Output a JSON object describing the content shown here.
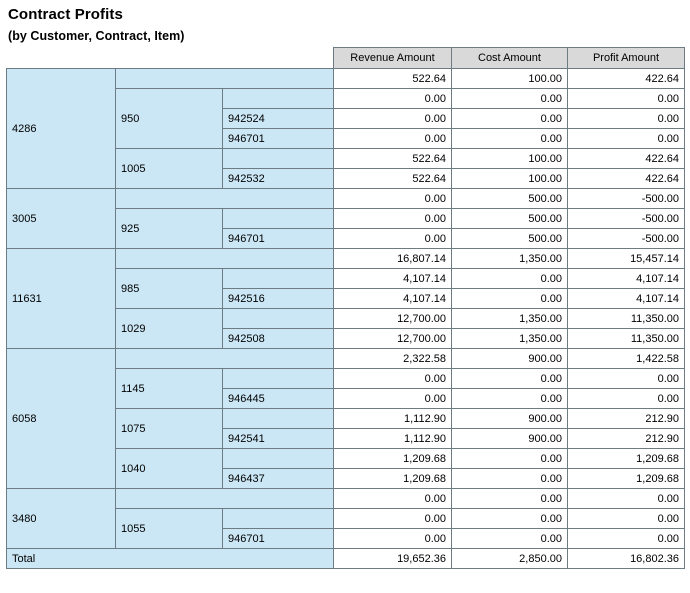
{
  "report": {
    "title": "Contract Profits",
    "subtitle": "(by Customer, Contract, Item)"
  },
  "table": {
    "columns": {
      "customer": "",
      "contract": "",
      "item": "",
      "revenue": "Revenue Amount",
      "cost": "Cost Amount",
      "profit": "Profit Amount"
    },
    "rows": [
      {
        "level": "customer",
        "customer": "4286",
        "contract": "",
        "item": "",
        "revenue": "522.64",
        "cost": "100.00",
        "profit": "422.64"
      },
      {
        "level": "contract",
        "customer": "",
        "contract": "950",
        "item": "",
        "revenue": "0.00",
        "cost": "0.00",
        "profit": "0.00"
      },
      {
        "level": "item",
        "customer": "",
        "contract": "",
        "item": "942524",
        "revenue": "0.00",
        "cost": "0.00",
        "profit": "0.00"
      },
      {
        "level": "item",
        "customer": "",
        "contract": "",
        "item": "946701",
        "revenue": "0.00",
        "cost": "0.00",
        "profit": "0.00"
      },
      {
        "level": "contract",
        "customer": "",
        "contract": "1005",
        "item": "",
        "revenue": "522.64",
        "cost": "100.00",
        "profit": "422.64"
      },
      {
        "level": "item",
        "customer": "",
        "contract": "",
        "item": "942532",
        "revenue": "522.64",
        "cost": "100.00",
        "profit": "422.64"
      },
      {
        "level": "customer",
        "customer": "3005",
        "contract": "",
        "item": "",
        "revenue": "0.00",
        "cost": "500.00",
        "profit": "-500.00"
      },
      {
        "level": "contract",
        "customer": "",
        "contract": "925",
        "item": "",
        "revenue": "0.00",
        "cost": "500.00",
        "profit": "-500.00"
      },
      {
        "level": "item",
        "customer": "",
        "contract": "",
        "item": "946701",
        "revenue": "0.00",
        "cost": "500.00",
        "profit": "-500.00"
      },
      {
        "level": "customer",
        "customer": "11631",
        "contract": "",
        "item": "",
        "revenue": "16,807.14",
        "cost": "1,350.00",
        "profit": "15,457.14"
      },
      {
        "level": "contract",
        "customer": "",
        "contract": "985",
        "item": "",
        "revenue": "4,107.14",
        "cost": "0.00",
        "profit": "4,107.14"
      },
      {
        "level": "item",
        "customer": "",
        "contract": "",
        "item": "942516",
        "revenue": "4,107.14",
        "cost": "0.00",
        "profit": "4,107.14"
      },
      {
        "level": "contract",
        "customer": "",
        "contract": "1029",
        "item": "",
        "revenue": "12,700.00",
        "cost": "1,350.00",
        "profit": "11,350.00"
      },
      {
        "level": "item",
        "customer": "",
        "contract": "",
        "item": "942508",
        "revenue": "12,700.00",
        "cost": "1,350.00",
        "profit": "11,350.00"
      },
      {
        "level": "customer",
        "customer": "6058",
        "contract": "",
        "item": "",
        "revenue": "2,322.58",
        "cost": "900.00",
        "profit": "1,422.58"
      },
      {
        "level": "contract",
        "customer": "",
        "contract": "1145",
        "item": "",
        "revenue": "0.00",
        "cost": "0.00",
        "profit": "0.00"
      },
      {
        "level": "item",
        "customer": "",
        "contract": "",
        "item": "946445",
        "revenue": "0.00",
        "cost": "0.00",
        "profit": "0.00"
      },
      {
        "level": "contract",
        "customer": "",
        "contract": "1075",
        "item": "",
        "revenue": "1,112.90",
        "cost": "900.00",
        "profit": "212.90"
      },
      {
        "level": "item",
        "customer": "",
        "contract": "",
        "item": "942541",
        "revenue": "1,112.90",
        "cost": "900.00",
        "profit": "212.90"
      },
      {
        "level": "contract",
        "customer": "",
        "contract": "1040",
        "item": "",
        "revenue": "1,209.68",
        "cost": "0.00",
        "profit": "1,209.68"
      },
      {
        "level": "item",
        "customer": "",
        "contract": "",
        "item": "946437",
        "revenue": "1,209.68",
        "cost": "0.00",
        "profit": "1,209.68"
      },
      {
        "level": "customer",
        "customer": "3480",
        "contract": "",
        "item": "",
        "revenue": "0.00",
        "cost": "0.00",
        "profit": "0.00"
      },
      {
        "level": "contract",
        "customer": "",
        "contract": "1055",
        "item": "",
        "revenue": "0.00",
        "cost": "0.00",
        "profit": "0.00"
      },
      {
        "level": "item",
        "customer": "",
        "contract": "",
        "item": "946701",
        "revenue": "0.00",
        "cost": "0.00",
        "profit": "0.00"
      }
    ],
    "total": {
      "label": "Total",
      "revenue": "19,652.36",
      "cost": "2,850.00",
      "profit": "16,802.36"
    }
  },
  "colors": {
    "group_background": "#cbe7f5",
    "header_background": "#d9d9d9",
    "border": "#6d7b83",
    "cell_background": "#ffffff"
  }
}
